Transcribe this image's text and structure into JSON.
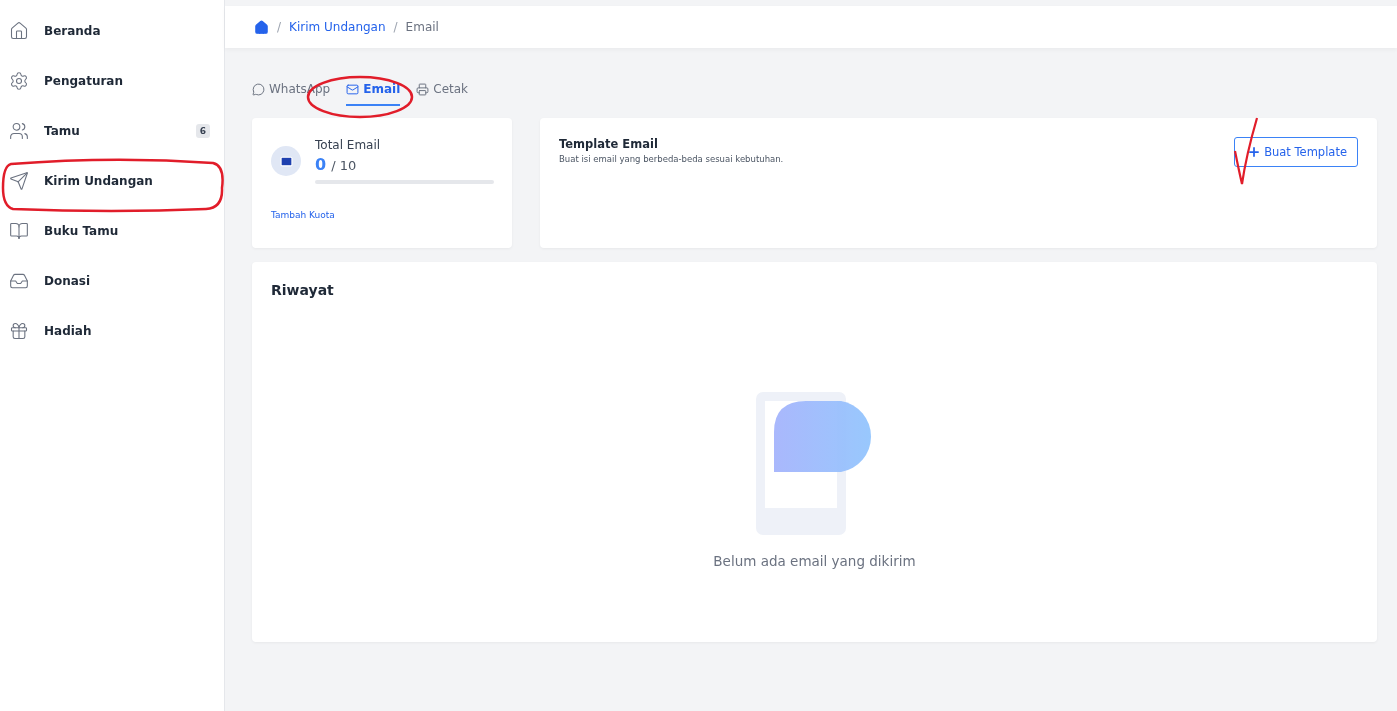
{
  "sidebar": {
    "items": [
      {
        "kind": "home",
        "label": "Beranda"
      },
      {
        "kind": "settings",
        "label": "Pengaturan"
      },
      {
        "kind": "users",
        "label": "Tamu",
        "badge": "6"
      },
      {
        "kind": "send",
        "label": "Kirim Undangan"
      },
      {
        "kind": "book",
        "label": "Buku Tamu"
      },
      {
        "kind": "donate",
        "label": "Donasi"
      },
      {
        "kind": "gift",
        "label": "Hadiah"
      }
    ]
  },
  "breadcrumb": [
    {
      "separator": "/",
      "label": "Kirim Undangan"
    },
    {
      "separator": "/",
      "label": "Email"
    }
  ],
  "tabs": [
    {
      "kind": "whatsapp",
      "label": "WhatsApp",
      "selected": false
    },
    {
      "kind": "email",
      "label": "Email",
      "selected": true
    },
    {
      "kind": "print",
      "label": "Cetak",
      "selected": false
    }
  ],
  "quota": {
    "title": "Total Email",
    "used": "0",
    "total": "/ 10",
    "level": 0,
    "link": "Tambah Kuota"
  },
  "template": {
    "title": "Template Email",
    "subtitle": "Buat isi email yang berbeda-beda sesuai kebutuhan.",
    "button": "Buat Template"
  },
  "history": {
    "title": "Riwayat",
    "empty_text": "Belum ada email yang dikirim"
  }
}
